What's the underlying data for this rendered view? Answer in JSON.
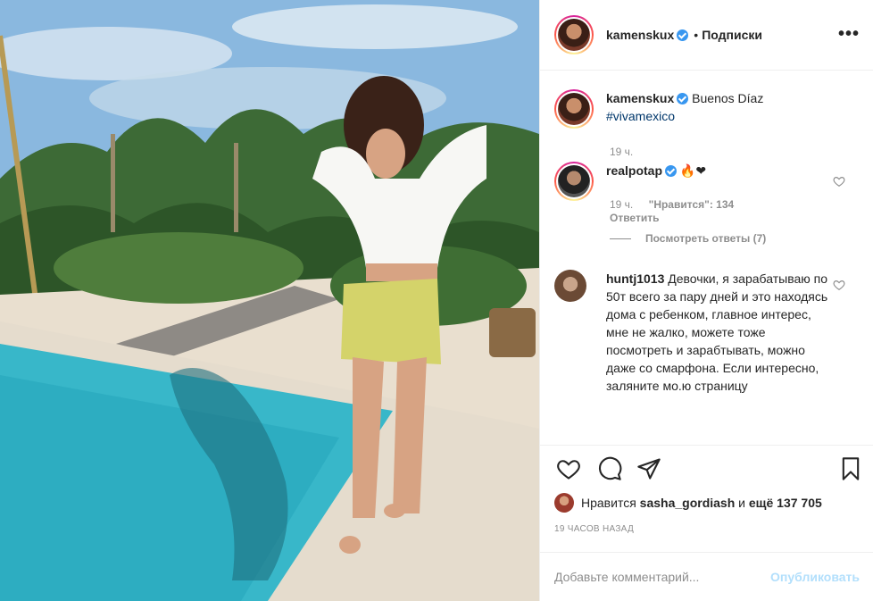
{
  "header": {
    "username": "kamenskux",
    "separator": "•",
    "follow_label": "Подписки",
    "more_label": "•••"
  },
  "caption": {
    "username": "kamenskux",
    "text": "Buenos Díaz",
    "hashtag": "#vivamexico",
    "time": "19 ч."
  },
  "comments": [
    {
      "username": "realpotap",
      "text": "🔥❤",
      "time": "19 ч.",
      "likes": "\"Нравится\": 134",
      "reply_label": "Ответить",
      "view_replies": "Посмотреть ответы (7)"
    },
    {
      "username": "huntj1013",
      "text": "Девочки, я зарабатываю по 50т всего за пару дней и это находясь дома с ребенком, главное интерес, мне не жалко, можете тоже посмотреть и зарабтывать, можно даже со смарфона. Если интересно, заляните мо.ю страницу"
    }
  ],
  "likes": {
    "prefix": "Нравится",
    "user": "sasha_gordiash",
    "and": "и",
    "rest": "ещё 137 705"
  },
  "timestamp": "19 ЧАСОВ НАЗАД",
  "add_comment": {
    "placeholder": "Добавьте комментарий...",
    "publish_label": "Опубликовать"
  },
  "colors": {
    "link": "#00376b",
    "muted": "#8e8e8e",
    "verified": "#3897f0",
    "publish_disabled": "#b2dffc"
  }
}
